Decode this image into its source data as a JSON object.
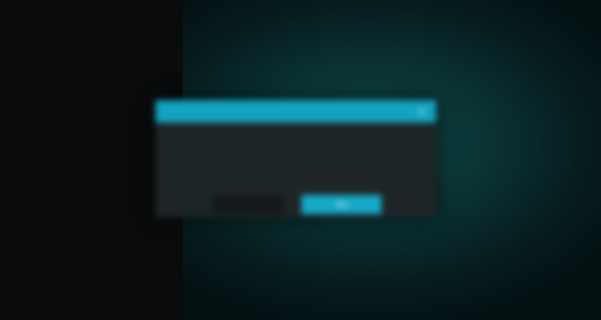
{
  "dialog": {
    "yes_label": "Yes",
    "close_icon": "close-icon"
  },
  "colors": {
    "accent": "#17a8c6",
    "warning_text": "#d5a017",
    "dialog_background": "#1e2526",
    "left_pane_background": "#090b0c",
    "right_pane_glow": "#0e4848"
  }
}
